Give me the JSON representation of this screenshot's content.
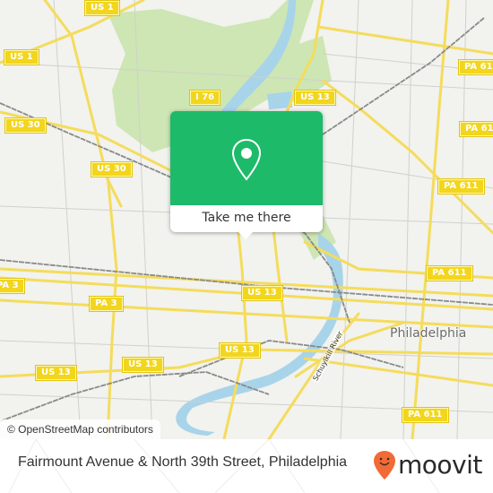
{
  "map": {
    "colors": {
      "background": "#f2f2ee",
      "park": "#cde6b4",
      "water": "#a8d4ea",
      "road_major": "#f4dc5c",
      "rail": "#888888",
      "shield": "#f2d51d"
    },
    "shields": [
      {
        "label": "US 1"
      },
      {
        "label": "US 1"
      },
      {
        "label": "US 30"
      },
      {
        "label": "US 30"
      },
      {
        "label": "I 76"
      },
      {
        "label": "US 13"
      },
      {
        "label": "PA 611"
      },
      {
        "label": "PA 611"
      },
      {
        "label": "PA 611"
      },
      {
        "label": "PA 611"
      },
      {
        "label": "PA 3"
      },
      {
        "label": "PA 3"
      },
      {
        "label": "US 13"
      },
      {
        "label": "US 13"
      },
      {
        "label": "US 13"
      },
      {
        "label": "US 13"
      },
      {
        "label": "PA 611"
      }
    ],
    "city_label": "Philadelphia",
    "river_label": "Schuylkill River",
    "attribution": "© OpenStreetMap contributors"
  },
  "popup": {
    "icon": "location-pin-icon",
    "button_label": "Take me there",
    "color": "#1dba6a"
  },
  "footer": {
    "title": "Fairmount Avenue & North 39th Street, Philadelphia",
    "brand": "moovit",
    "brand_icon": "moovit-smiley-pin-icon",
    "brand_color": "#f26a35"
  }
}
